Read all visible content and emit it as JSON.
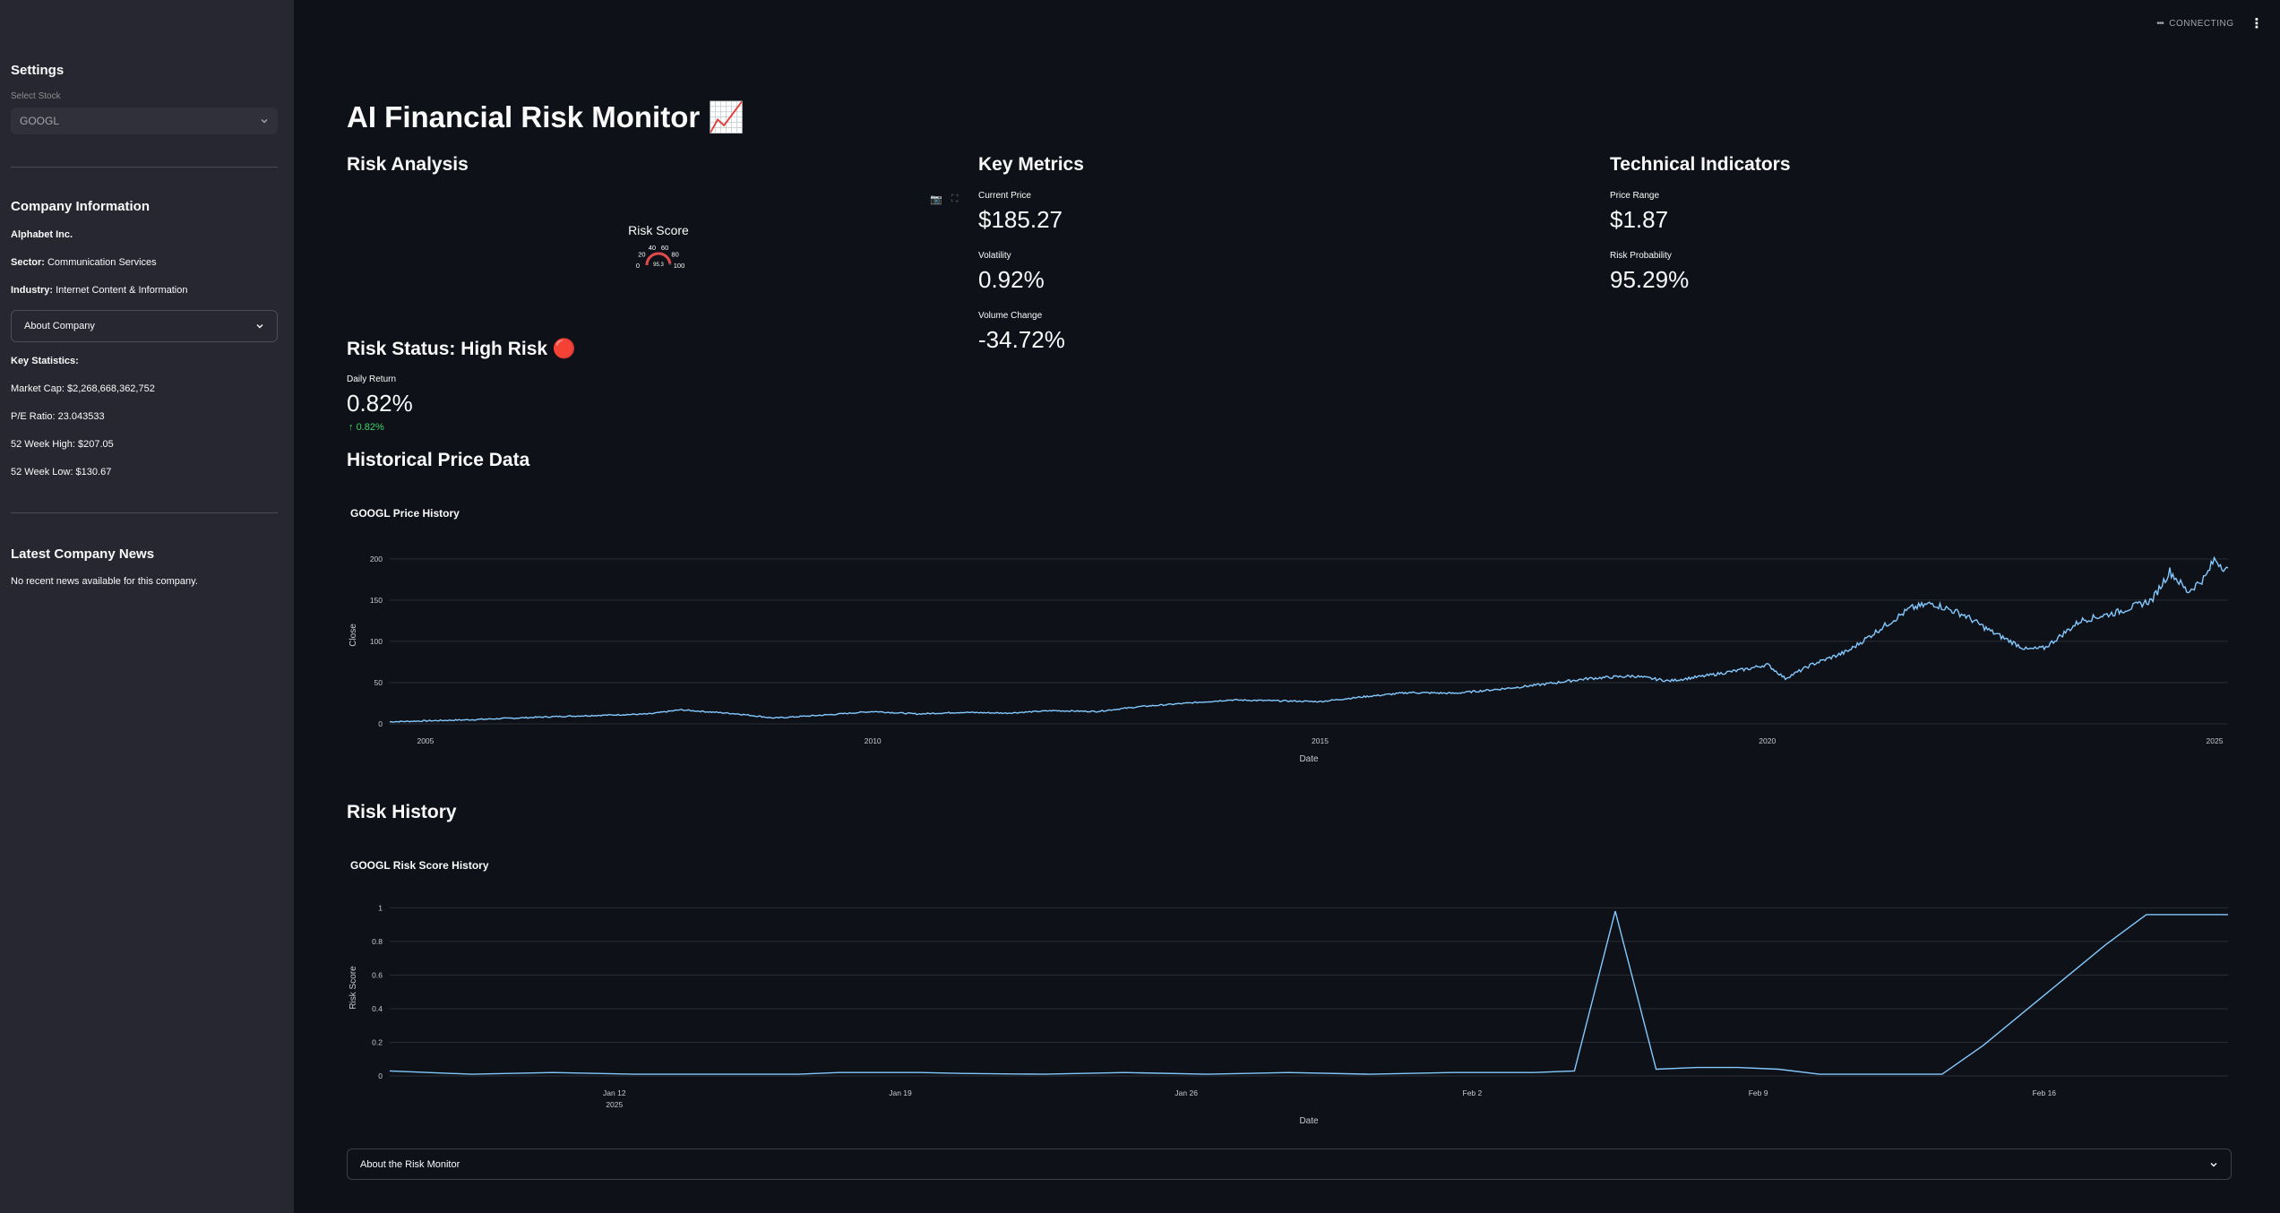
{
  "sidebar": {
    "settings_heading": "Settings",
    "select_label": "Select Stock",
    "select_value": "GOOGL",
    "company_info_heading": "Company Information",
    "company_name": "Alphabet Inc.",
    "sector_label": "Sector:",
    "sector_value": "Communication Services",
    "industry_label": "Industry:",
    "industry_value": "Internet Content & Information",
    "about_company_label": "About Company",
    "key_stats_heading": "Key Statistics:",
    "market_cap": "Market Cap: $2,268,668,362,752",
    "pe_ratio": "P/E Ratio: 23.043533",
    "week_high": "52 Week High: $207.05",
    "week_low": "52 Week Low: $130.67",
    "news_heading": "Latest Company News",
    "news_text": "No recent news available for this company."
  },
  "status": {
    "connecting": "CONNECTING"
  },
  "main": {
    "title": "AI Financial Risk Monitor 📈",
    "risk_analysis_heading": "Risk Analysis",
    "key_metrics_heading": "Key Metrics",
    "technical_heading": "Technical Indicators",
    "gauge": {
      "title": "Risk Score",
      "value": 95.3,
      "value_label": "95.3",
      "ticks": [
        "0",
        "20",
        "40",
        "60",
        "80",
        "100"
      ]
    },
    "metrics": {
      "current_price_label": "Current Price",
      "current_price": "$185.27",
      "volatility_label": "Volatility",
      "volatility": "0.92%",
      "volume_change_label": "Volume Change",
      "volume_change": "-34.72%",
      "price_range_label": "Price Range",
      "price_range": "$1.87",
      "risk_prob_label": "Risk Probability",
      "risk_prob": "95.29%"
    },
    "risk_status_heading": "Risk Status: High Risk 🔴",
    "daily_return_label": "Daily Return",
    "daily_return": "0.82%",
    "daily_return_delta": "0.82%",
    "historical_heading": "Historical Price Data",
    "risk_history_heading": "Risk History",
    "about_monitor_label": "About the Risk Monitor"
  },
  "chart_data": [
    {
      "type": "line",
      "title": "GOOGL Price History",
      "xlabel": "Date",
      "ylabel": "Close",
      "xlim": [
        2004.6,
        2025.15
      ],
      "ylim": [
        0,
        215
      ],
      "x_ticks": [
        "2005",
        "2010",
        "2015",
        "2020",
        "2025"
      ],
      "y_ticks": [
        "0",
        "50",
        "100",
        "150",
        "200"
      ],
      "x": [
        2004.6,
        2005.5,
        2006.5,
        2007.5,
        2007.85,
        2008.5,
        2008.9,
        2009.5,
        2010.0,
        2010.5,
        2011.0,
        2011.5,
        2012.0,
        2012.5,
        2013.0,
        2013.5,
        2014.0,
        2014.5,
        2015.0,
        2015.5,
        2016.0,
        2016.5,
        2017.0,
        2017.5,
        2018.0,
        2018.5,
        2018.9,
        2019.3,
        2019.8,
        2020.0,
        2020.2,
        2020.5,
        2020.9,
        2021.3,
        2021.6,
        2021.85,
        2022.2,
        2022.5,
        2022.9,
        2023.1,
        2023.5,
        2023.9,
        2024.3,
        2024.5,
        2024.7,
        2024.9,
        2025.0,
        2025.15
      ],
      "y": [
        2.5,
        5,
        9,
        12,
        17,
        12,
        7,
        11,
        15,
        12,
        14,
        13,
        16,
        15,
        21,
        25,
        29,
        28,
        27,
        33,
        38,
        37,
        42,
        48,
        55,
        58,
        52,
        58,
        67,
        72,
        55,
        72,
        88,
        118,
        140,
        146,
        132,
        112,
        90,
        92,
        125,
        135,
        150,
        185,
        160,
        178,
        200,
        185
      ]
    },
    {
      "type": "line",
      "title": "GOOGL Risk Score History",
      "xlabel": "Date",
      "ylabel": "Risk Score",
      "xlim": [
        0,
        45
      ],
      "ylim": [
        0,
        1.05
      ],
      "x_ticks": [
        "Jan 12",
        "Jan 19",
        "Jan 26",
        "Feb 2",
        "Feb 9",
        "Feb 16"
      ],
      "x_tick_sub": "2025",
      "y_ticks": [
        "0",
        "0.2",
        "0.4",
        "0.6",
        "0.8",
        "1"
      ],
      "x": [
        0,
        2,
        4,
        6,
        8,
        10,
        11,
        12,
        13,
        14,
        16,
        18,
        20,
        22,
        24,
        26,
        28,
        29,
        30,
        31,
        32,
        33,
        34,
        35,
        36,
        37,
        38,
        39,
        40,
        41,
        42,
        43,
        44,
        45
      ],
      "y": [
        0.03,
        0.01,
        0.02,
        0.01,
        0.01,
        0.01,
        0.02,
        0.02,
        0.02,
        0.015,
        0.01,
        0.02,
        0.01,
        0.02,
        0.01,
        0.02,
        0.02,
        0.03,
        0.98,
        0.04,
        0.05,
        0.05,
        0.04,
        0.01,
        0.01,
        0.01,
        0.01,
        0.18,
        0.38,
        0.58,
        0.78,
        0.96,
        0.96,
        0.96
      ]
    }
  ]
}
